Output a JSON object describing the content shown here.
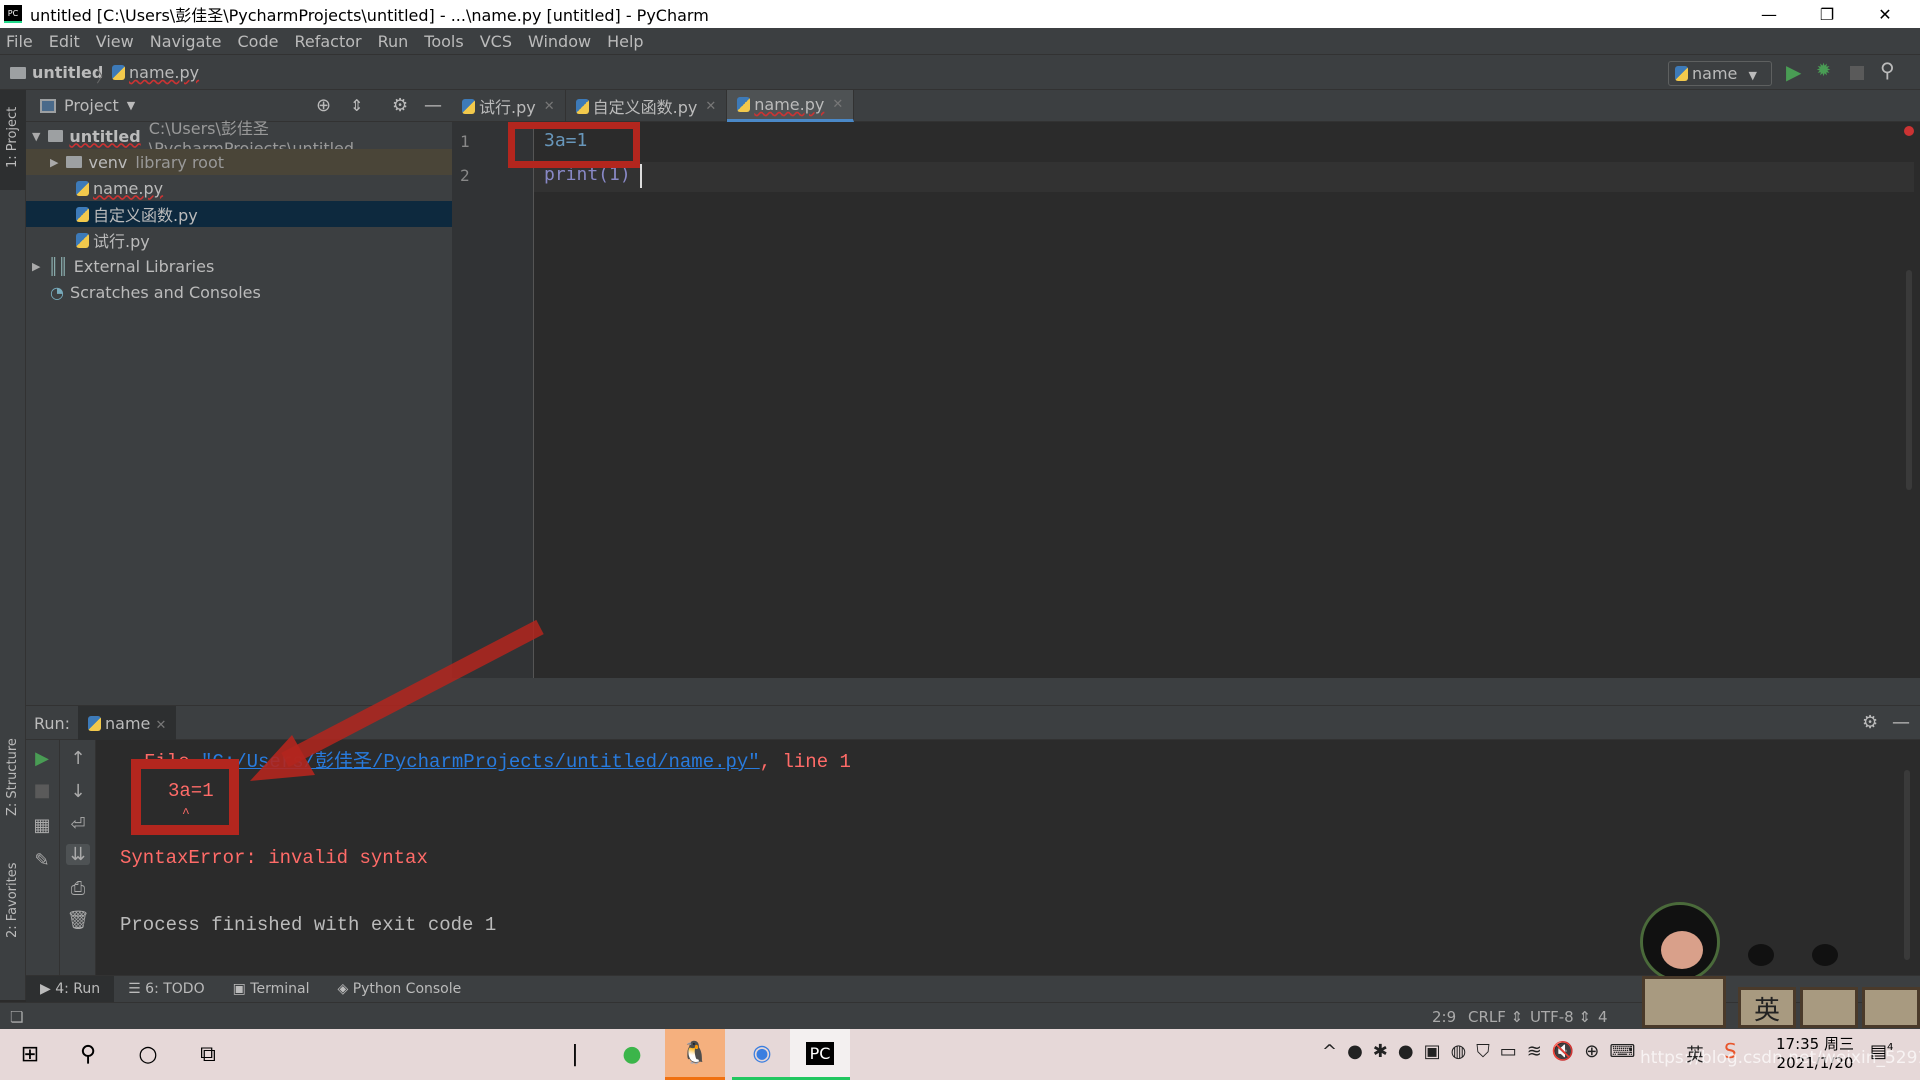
{
  "window": {
    "title": "untitled [C:\\Users\\彭佳圣\\PycharmProjects\\untitled] - ...\\name.py [untitled] - PyCharm",
    "app_logo": "PC"
  },
  "menu": [
    "File",
    "Edit",
    "View",
    "Navigate",
    "Code",
    "Refactor",
    "Run",
    "Tools",
    "VCS",
    "Window",
    "Help"
  ],
  "breadcrumb": {
    "project": "untitled",
    "file": "name.py"
  },
  "toolbar": {
    "run_config": "name"
  },
  "side_stripes": {
    "project": "1: Project",
    "structure": "Z: Structure",
    "favorites": "2: Favorites"
  },
  "project_panel": {
    "title": "Project",
    "root": {
      "name": "untitled",
      "path": "C:\\Users\\彭佳圣\\PycharmProjects\\untitled"
    },
    "items": [
      {
        "name": "venv",
        "note": "library root"
      },
      {
        "name": "name.py"
      },
      {
        "name": "自定义函数.py",
        "selected": true
      },
      {
        "name": "试行.py"
      }
    ],
    "external": "External Libraries",
    "scratches": "Scratches and Consoles"
  },
  "editor": {
    "tabs": [
      {
        "label": "试行.py"
      },
      {
        "label": "自定义函数.py"
      },
      {
        "label": "name.py",
        "active": true
      }
    ],
    "lines": [
      {
        "num": "1",
        "code": "3a=1"
      },
      {
        "num": "2",
        "code": "print(1)"
      }
    ]
  },
  "run_panel": {
    "label": "Run:",
    "tab": "name",
    "output": {
      "file_prefix": "File ",
      "file_path": "\"C:/Users/彭佳圣/PycharmProjects/untitled/name.py\"",
      "file_suffix": ", line 1",
      "code_line": "3a=1",
      "caret": "^",
      "error": "SyntaxError: invalid syntax",
      "exit": "Process finished with exit code 1"
    }
  },
  "bottom_tabs": [
    "4: Run",
    "6: TODO",
    "Terminal",
    "Python Console"
  ],
  "status_bar": {
    "position": "2:9",
    "line_sep": "CRLF",
    "encoding": "UTF-8",
    "indent": "4"
  },
  "taskbar": {
    "time": "17:35 周三",
    "date": "2021/1/20",
    "ime": "英",
    "notifications": "4"
  },
  "watermark": "https://blog.csdn.net/weixin_52919066",
  "colors": {
    "annotation": "#b3261e",
    "error_text": "#ff6b68",
    "link": "#287bde",
    "accent": "#4a88c7"
  }
}
